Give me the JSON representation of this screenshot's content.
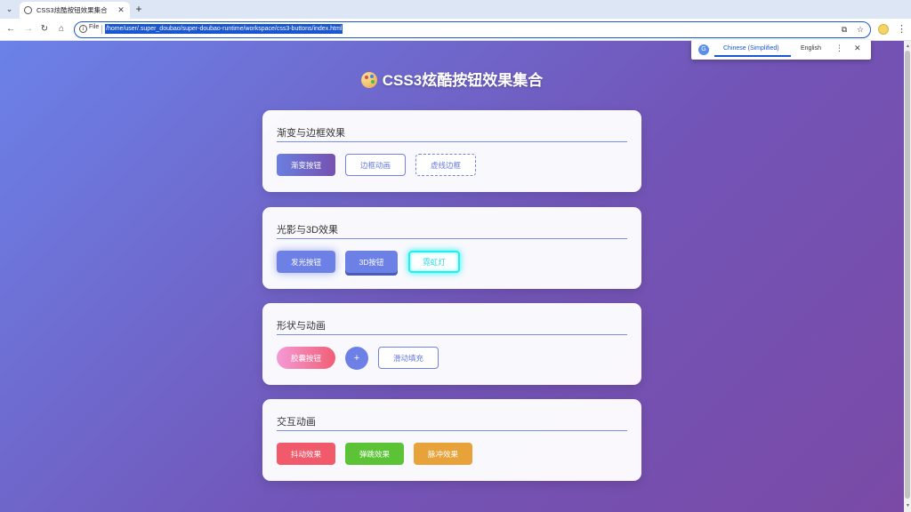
{
  "browser": {
    "tab_title": "CSS3炫酷按钮效果集合",
    "tab_close": "✕",
    "new_tab": "+",
    "scheme_label": "File",
    "url": "/home/user/.super_doubao/super-doubao-runtime/workspace/css3-buttons/index.html"
  },
  "translate_bar": {
    "source_language": "Chinese (Simplified)",
    "target_language": "English",
    "more": "⋮",
    "close": "✕"
  },
  "page": {
    "title": "CSS3炫酷按钮效果集合",
    "sections": [
      {
        "title": "渐变与边框效果",
        "buttons": [
          "渐变按钮",
          "边框动画",
          "虚线边框"
        ]
      },
      {
        "title": "光影与3D效果",
        "buttons": [
          "发光按钮",
          "3D按钮",
          "霓虹灯"
        ]
      },
      {
        "title": "形状与动画",
        "buttons": [
          "胶囊按钮",
          "+",
          "滑动填充"
        ]
      },
      {
        "title": "交互动画",
        "buttons": [
          "抖动效果",
          "弹跳效果",
          "脉冲效果"
        ]
      }
    ]
  },
  "colors": {
    "page_gradient_start": "#6b82e8",
    "page_gradient_end": "#7a4aa6",
    "accent": "#6d80e6",
    "neon": "#1ff0f0",
    "shake": "#f05a6b",
    "bounce": "#5cc336",
    "pulse": "#e8a23a"
  },
  "icons": [
    "palette-icon",
    "info-icon",
    "translate-icon",
    "star-icon",
    "extension-icon",
    "menu-icon"
  ]
}
